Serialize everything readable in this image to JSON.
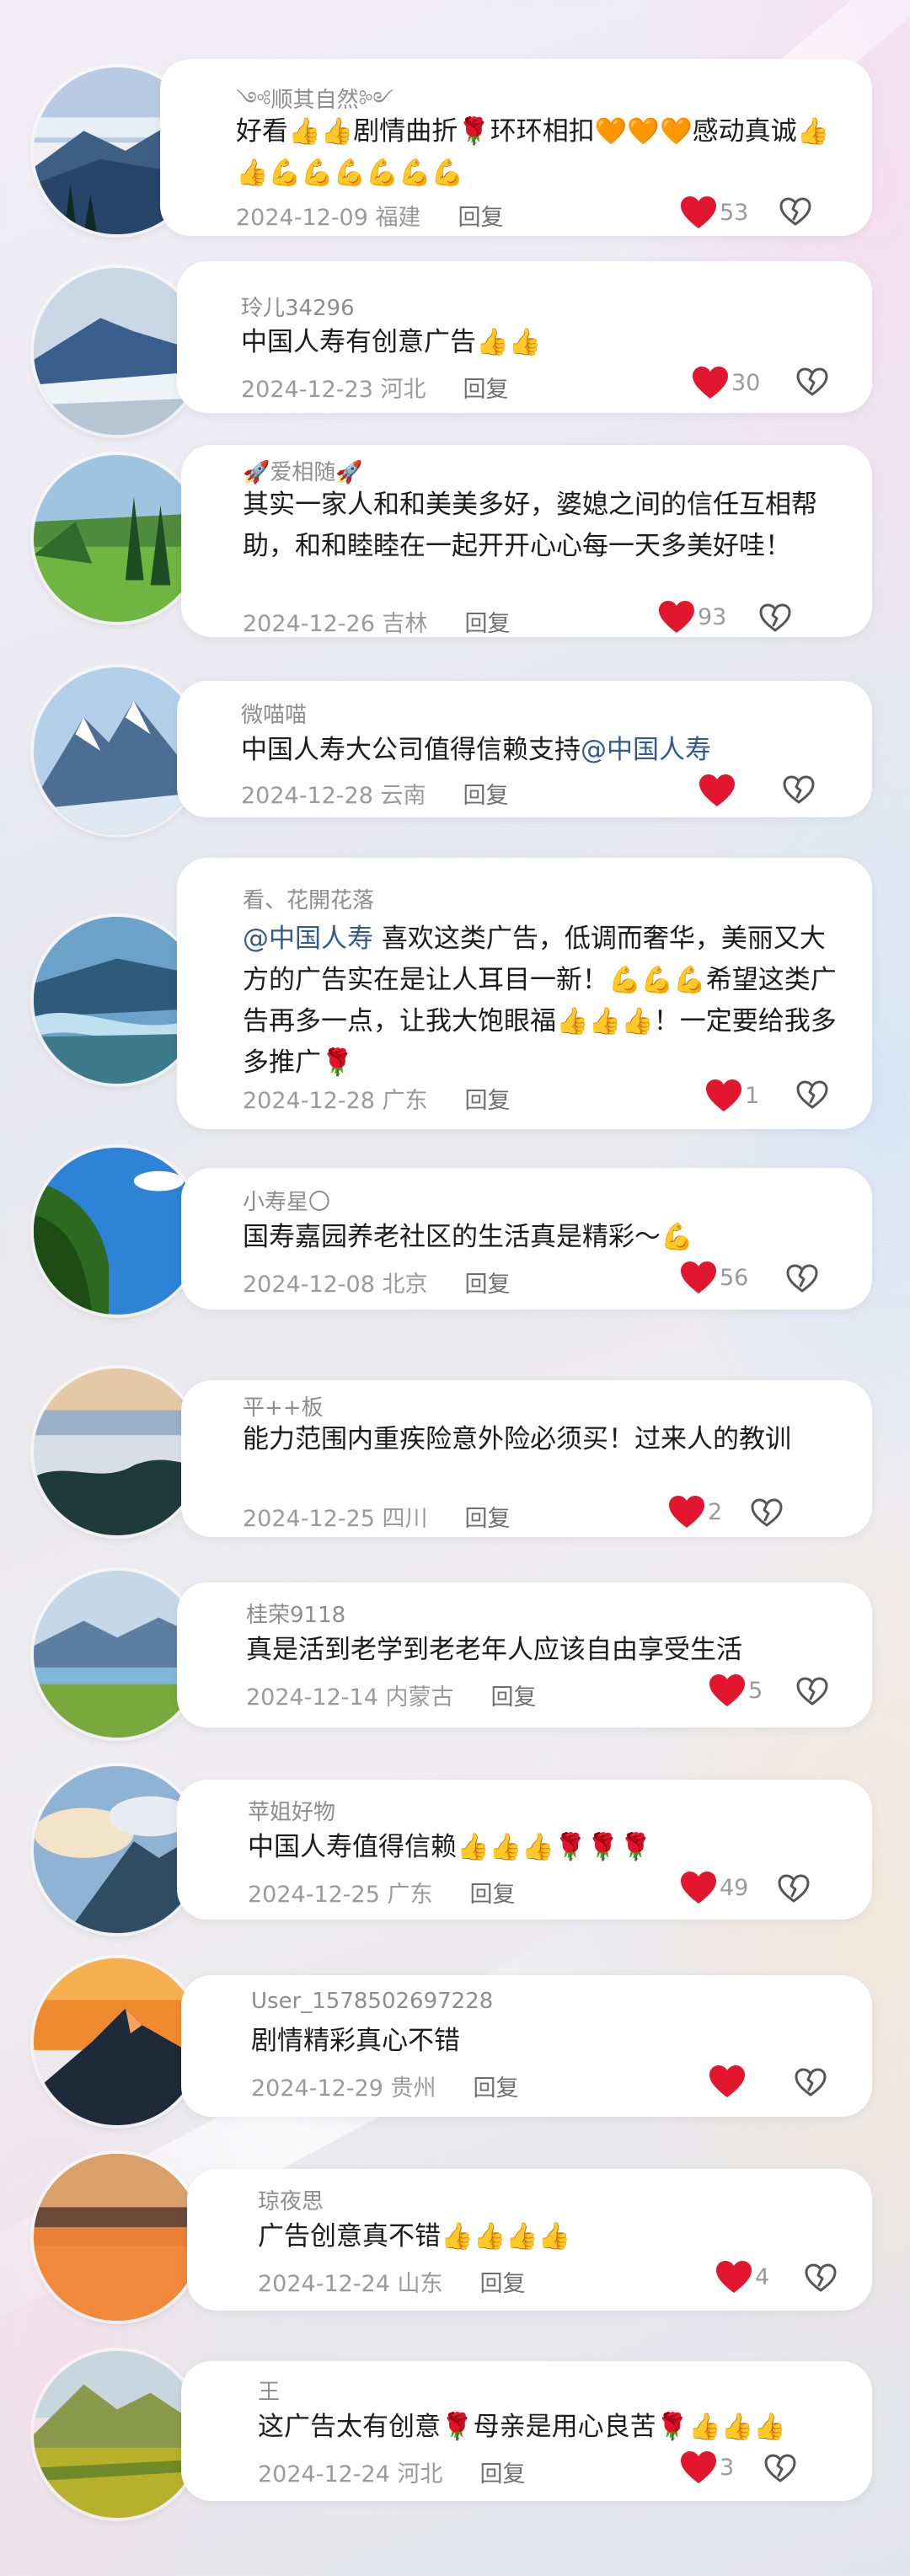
{
  "comments": [
    {
      "user": "༺顺其自然༻",
      "text": "好看👍👍剧情曲折🌹环环相扣🧡🧡🧡感动真诚👍👍💪💪💪💪💪💪",
      "date": "2024-12-09 福建",
      "reply": "回复",
      "likes": "53"
    },
    {
      "user": "玲儿34296",
      "text": "中国人寿有创意广告👍👍",
      "date": "2024-12-23 河北",
      "reply": "回复",
      "likes": "30"
    },
    {
      "user": "🚀爱相随🚀",
      "text": "其实一家人和和美美多好，婆媳之间的信任互相帮助，和和睦睦在一起开开心心每一天多美好哇！",
      "date": "2024-12-26 吉林",
      "reply": "回复",
      "likes": "93"
    },
    {
      "user": "微喵喵",
      "text_before": "中国人寿大公司值得信赖支持",
      "mention": "@中国人寿",
      "date": "2024-12-28 云南",
      "reply": "回复",
      "likes": ""
    },
    {
      "user": "看、花開花落",
      "mention": "@中国人寿",
      "text_after": " 喜欢这类广告，低调而奢华，美丽又大方的广告实在是让人耳目一新！💪💪💪希望这类广告再多一点，让我大饱眼福👍👍👍！一定要给我多多推广🌹",
      "date": "2024-12-28 广东",
      "reply": "回复",
      "likes": "1"
    },
    {
      "user": "小寿星〇",
      "text": "国寿嘉园养老社区的生活真是精彩～💪",
      "date": "2024-12-08 北京",
      "reply": "回复",
      "likes": "56"
    },
    {
      "user": "平++板",
      "text": "能力范围内重疾险意外险必须买！过来人的教训",
      "date": "2024-12-25 四川",
      "reply": "回复",
      "likes": "2"
    },
    {
      "user": "桂荣9118",
      "text": "真是活到老学到老老年人应该自由享受生活",
      "date": "2024-12-14 内蒙古",
      "reply": "回复",
      "likes": "5"
    },
    {
      "user": "苹姐好物",
      "text": "中国人寿值得信赖👍👍👍🌹🌹🌹",
      "date": "2024-12-25 广东",
      "reply": "回复",
      "likes": "49"
    },
    {
      "user": "User_1578502697228",
      "text": "剧情精彩真心不错",
      "date": "2024-12-29 贵州",
      "reply": "回复",
      "likes": ""
    },
    {
      "user": "琼夜思",
      "text": "广告创意真不错👍👍👍👍",
      "date": "2024-12-24 山东",
      "reply": "回复",
      "likes": "4"
    },
    {
      "user": "王",
      "text": "这广告太有创意🌹母亲是用心良苦🌹👍👍👍",
      "date": "2024-12-24 河北",
      "reply": "回复",
      "likes": "3"
    }
  ],
  "icons": {
    "like": "heart-icon",
    "dislike": "broken-heart-icon",
    "like_color": "#e2162e"
  }
}
